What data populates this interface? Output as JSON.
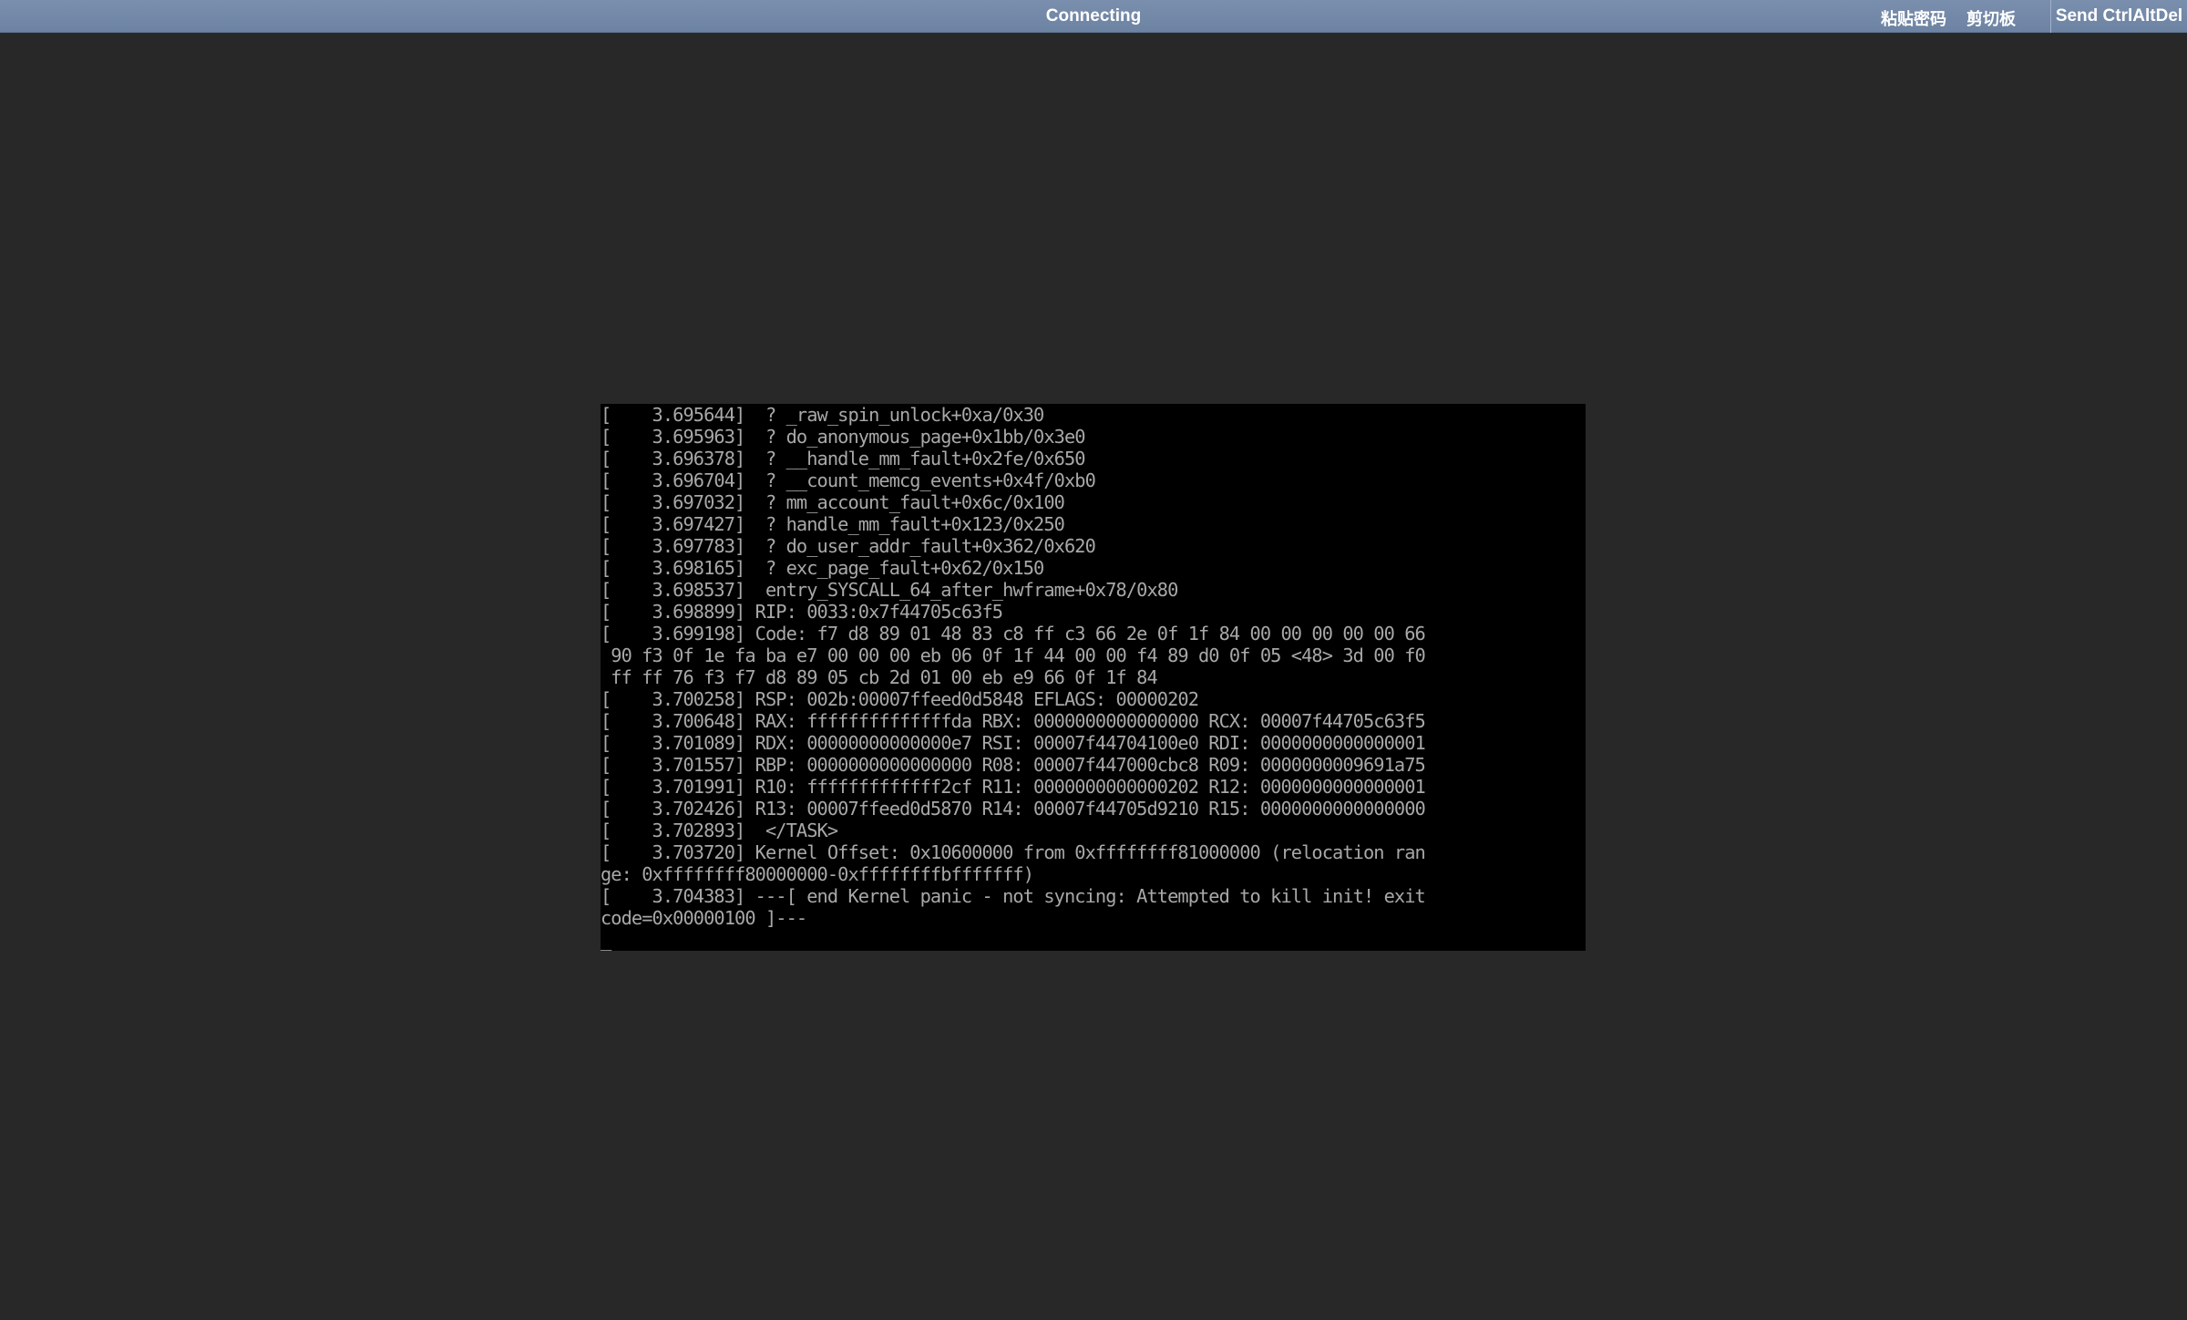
{
  "toolbar": {
    "status": "Connecting",
    "paste_password": "粘贴密码",
    "clipboard": "剪切板",
    "send_ctrl_alt_del": "Send CtrlAltDel"
  },
  "console": {
    "lines": [
      "[    3.695644]  ? _raw_spin_unlock+0xa/0x30",
      "[    3.695963]  ? do_anonymous_page+0x1bb/0x3e0",
      "[    3.696378]  ? __handle_mm_fault+0x2fe/0x650",
      "[    3.696704]  ? __count_memcg_events+0x4f/0xb0",
      "[    3.697032]  ? mm_account_fault+0x6c/0x100",
      "[    3.697427]  ? handle_mm_fault+0x123/0x250",
      "[    3.697783]  ? do_user_addr_fault+0x362/0x620",
      "[    3.698165]  ? exc_page_fault+0x62/0x150",
      "[    3.698537]  entry_SYSCALL_64_after_hwframe+0x78/0x80",
      "[    3.698899] RIP: 0033:0x7f44705c63f5",
      "[    3.699198] Code: f7 d8 89 01 48 83 c8 ff c3 66 2e 0f 1f 84 00 00 00 00 00 66",
      " 90 f3 0f 1e fa ba e7 00 00 00 eb 06 0f 1f 44 00 00 f4 89 d0 0f 05 <48> 3d 00 f0",
      " ff ff 76 f3 f7 d8 89 05 cb 2d 01 00 eb e9 66 0f 1f 84",
      "[    3.700258] RSP: 002b:00007ffeed0d5848 EFLAGS: 00000202",
      "[    3.700648] RAX: ffffffffffffffda RBX: 0000000000000000 RCX: 00007f44705c63f5",
      "[    3.701089] RDX: 00000000000000e7 RSI: 00007f44704100e0 RDI: 0000000000000001",
      "[    3.701557] RBP: 0000000000000000 R08: 00007f447000cbc8 R09: 0000000009691a75",
      "[    3.701991] R10: fffffffffffff2cf R11: 0000000000000202 R12: 0000000000000001",
      "[    3.702426] R13: 00007ffeed0d5870 R14: 00007f44705d9210 R15: 0000000000000000",
      "[    3.702893]  </TASK>",
      "[    3.703720] Kernel Offset: 0x10600000 from 0xffffffff81000000 (relocation ran",
      "ge: 0xffffffff80000000-0xffffffffbfffffff)",
      "[    3.704383] ---[ end Kernel panic - not syncing: Attempted to kill init! exit",
      "code=0x00000100 ]---",
      "_"
    ]
  }
}
